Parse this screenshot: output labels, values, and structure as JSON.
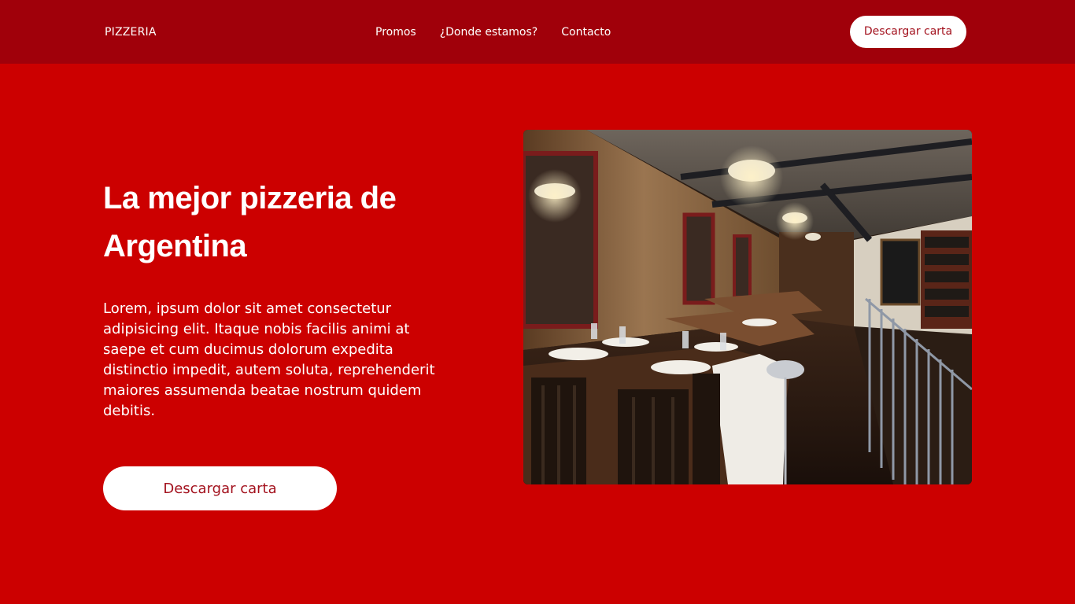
{
  "header": {
    "brand": "PIZZERIA",
    "nav": [
      {
        "label": "Promos"
      },
      {
        "label": "¿Donde estamos?"
      },
      {
        "label": "Contacto"
      }
    ],
    "cta_label": "Descargar carta"
  },
  "hero": {
    "title": "La mejor pizzeria de Argentina",
    "text": "Lorem, ipsum dolor sit amet consectetur adipisicing elit. Itaque nobis facilis animi at saepe et cum ducimus dolorum expedita distinctio impedit, autem soluta, reprehenderit maiores assumenda beatae nostrum quidem debitis.",
    "cta_label": "Descargar carta"
  },
  "colors": {
    "page_background": "#cc0000",
    "header_background": "#a0000a",
    "button_background": "#ffffff",
    "button_text": "#a3121e",
    "text": "#ffffff"
  }
}
